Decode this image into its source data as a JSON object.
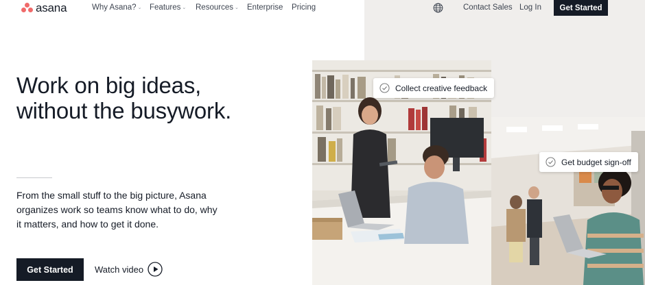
{
  "brand": {
    "name": "asana",
    "accent": "#f06a6a",
    "dark": "#151b26"
  },
  "nav": {
    "links": [
      {
        "label": "Why Asana?",
        "has_dropdown": true
      },
      {
        "label": "Features",
        "has_dropdown": true
      },
      {
        "label": "Resources",
        "has_dropdown": true
      },
      {
        "label": "Enterprise",
        "has_dropdown": false
      },
      {
        "label": "Pricing",
        "has_dropdown": false
      }
    ],
    "language_icon": "globe-icon",
    "contact_sales": "Contact Sales",
    "log_in": "Log In",
    "get_started": "Get Started",
    "dropdown_icon": "chevron-down-icon"
  },
  "hero": {
    "headline_line1": "Work on big ideas,",
    "headline_line2": "without the busywork.",
    "subtext": "From the small stuff to the big picture, Asana organizes work so teams know what to do, why it matters, and how to get it done.",
    "cta_label": "Get Started",
    "watch_label": "Watch video",
    "watch_icon": "play-circle-icon"
  },
  "images": {
    "tags": [
      {
        "label": "Collect creative feedback",
        "icon": "check-circle-icon"
      },
      {
        "label": "Get budget sign-off",
        "icon": "check-circle-icon"
      }
    ]
  }
}
